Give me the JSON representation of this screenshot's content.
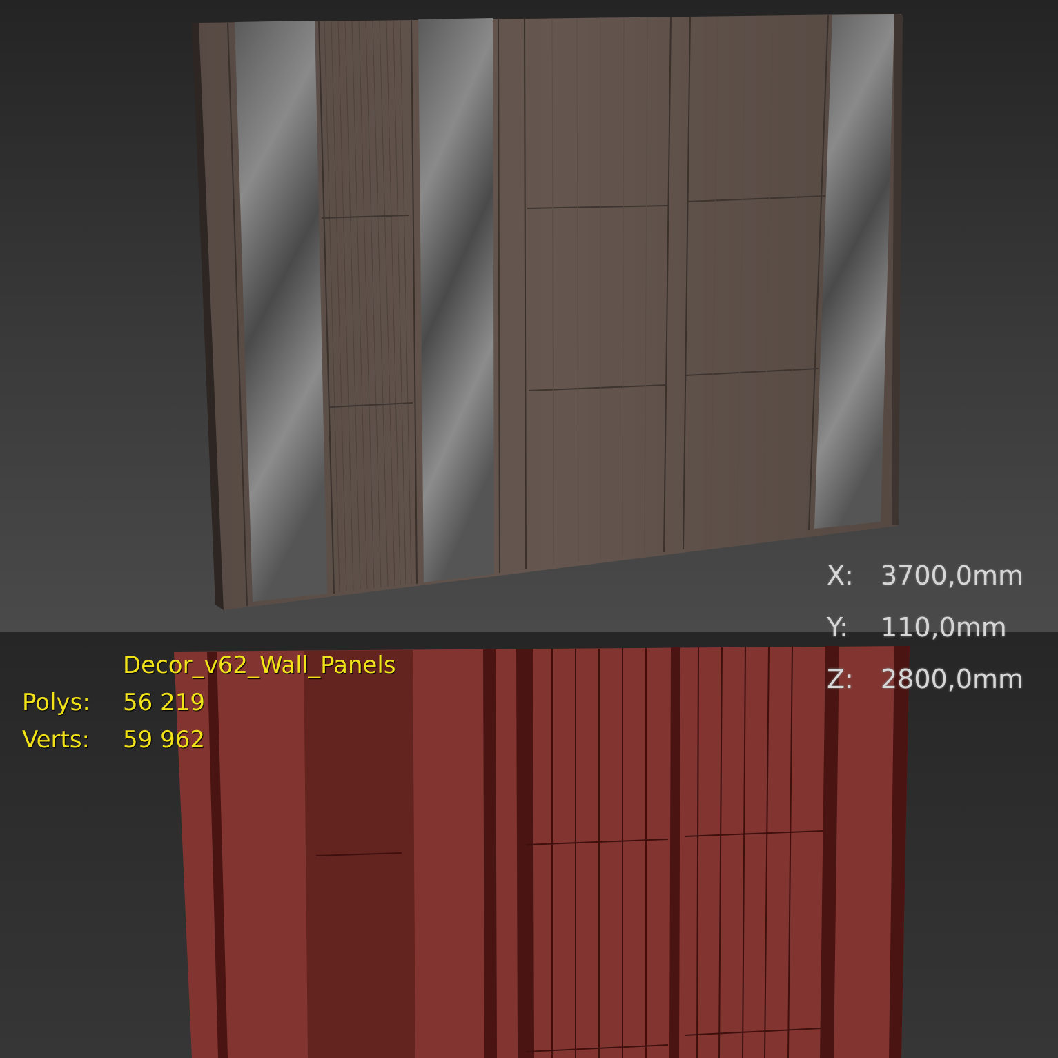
{
  "object": {
    "name": "Decor_v62_Wall_Panels"
  },
  "stats": [
    {
      "label": "Polys:",
      "value": "56 219"
    },
    {
      "label": "Verts:",
      "value": "59 962"
    }
  ],
  "dimensions": [
    {
      "label": "X:",
      "value": "3700,0mm"
    },
    {
      "label": "Y:",
      "value": "110,0mm"
    },
    {
      "label": "Z:",
      "value": "2800,0mm"
    }
  ],
  "colors": {
    "stats_text": "#f2e21a",
    "dimension_text": "#d6d6d6",
    "wireframe_fill": "#823530",
    "wood": "#5f524b",
    "marble": "#6f6f6f"
  }
}
